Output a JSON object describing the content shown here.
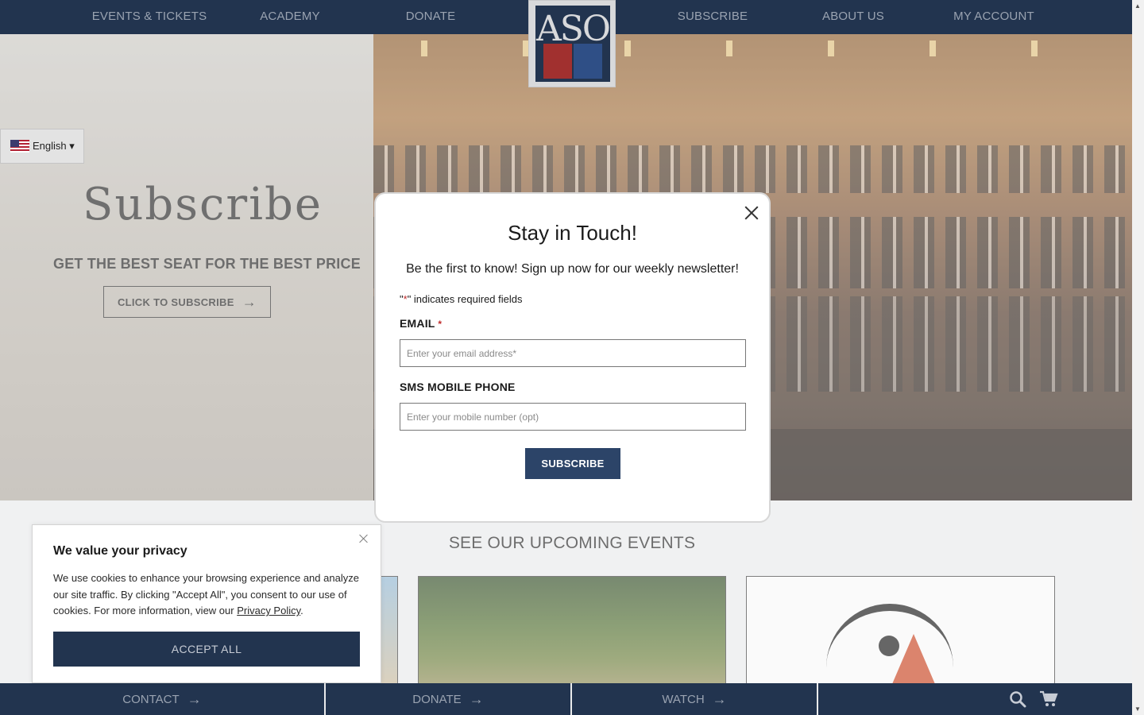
{
  "nav": {
    "left": [
      "EVENTS & TICKETS",
      "ACADEMY",
      "DONATE"
    ],
    "right": [
      "SUBSCRIBE",
      "ABOUT US",
      "MY ACCOUNT"
    ],
    "logo_text": "ASO"
  },
  "language": {
    "label": "English ▾"
  },
  "hero": {
    "title": "Subscribe",
    "subtitle": "GET THE BEST SEAT FOR THE BEST PRICE",
    "button": "CLICK TO SUBSCRIBE",
    "button_arrow": "→"
  },
  "modal": {
    "title": "Stay in Touch!",
    "lead": "Be the first to know! Sign up now for our weekly newsletter!",
    "required_note_pre": "\"",
    "required_note_star": "*",
    "required_note_post": "\" indicates required fields",
    "email_label": "EMAIL",
    "email_required": "*",
    "email_placeholder": "Enter your email address*",
    "phone_label": "SMS MOBILE PHONE",
    "phone_placeholder": "Enter your mobile number (opt)",
    "submit": "SUBSCRIBE"
  },
  "events": {
    "title": "SEE OUR UPCOMING EVENTS"
  },
  "cookie": {
    "title": "We value your privacy",
    "text": "We use cookies to enhance your browsing experience and analyze our site traffic. By clicking \"Accept All\", you consent to our use of cookies. For more information, view our ",
    "link": "Privacy Policy",
    "text_end": ".",
    "accept": "ACCEPT ALL"
  },
  "bottombar": {
    "items": [
      "CONTACT",
      "DONATE",
      "WATCH"
    ],
    "arrow": "→",
    "icons": [
      "search-icon",
      "cart-icon"
    ]
  },
  "colors": {
    "navy": "#22344f",
    "button": "#2c4468",
    "required": "#c02b2b"
  }
}
